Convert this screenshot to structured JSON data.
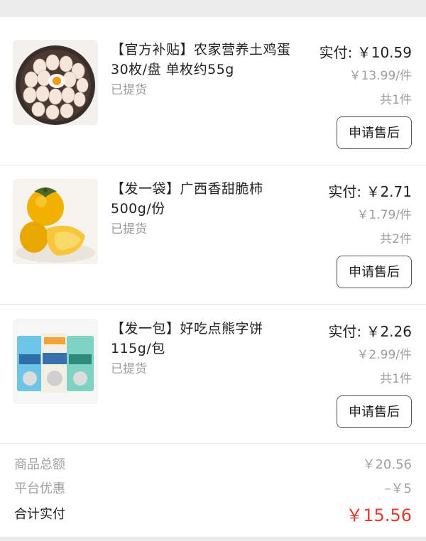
{
  "items": [
    {
      "title": "【官方补贴】农家营养土鸡蛋 30枚/盘 单枚约55g",
      "status": "已提货",
      "paid": "实付: ￥10.59",
      "unit_price": "￥13.99/件",
      "quantity": "共1件",
      "button": "申请售后",
      "image": "eggs-photo"
    },
    {
      "title": "【发一袋】广西香甜脆柿 500g/份",
      "status": "已提货",
      "paid": "实付: ￥2.71",
      "unit_price": "￥1.79/件",
      "quantity": "共2件",
      "button": "申请售后",
      "image": "persimmon-photo"
    },
    {
      "title": "【发一包】好吃点熊字饼 115g/包",
      "status": "已提货",
      "paid": "实付: ￥2.26",
      "unit_price": "￥2.99/件",
      "quantity": "共1件",
      "button": "申请售后",
      "image": "biscuit-bags-photo"
    }
  ],
  "summary": {
    "goods_total_label": "商品总额",
    "goods_total_value": "￥20.56",
    "discount_label": "平台优惠",
    "discount_value": "–￥5",
    "total_label": "合计实付",
    "total_value": "￥15.56"
  },
  "colors": {
    "accent_price": "#e23b2e",
    "muted_text": "#9e9e9e",
    "background": "#ececec"
  }
}
